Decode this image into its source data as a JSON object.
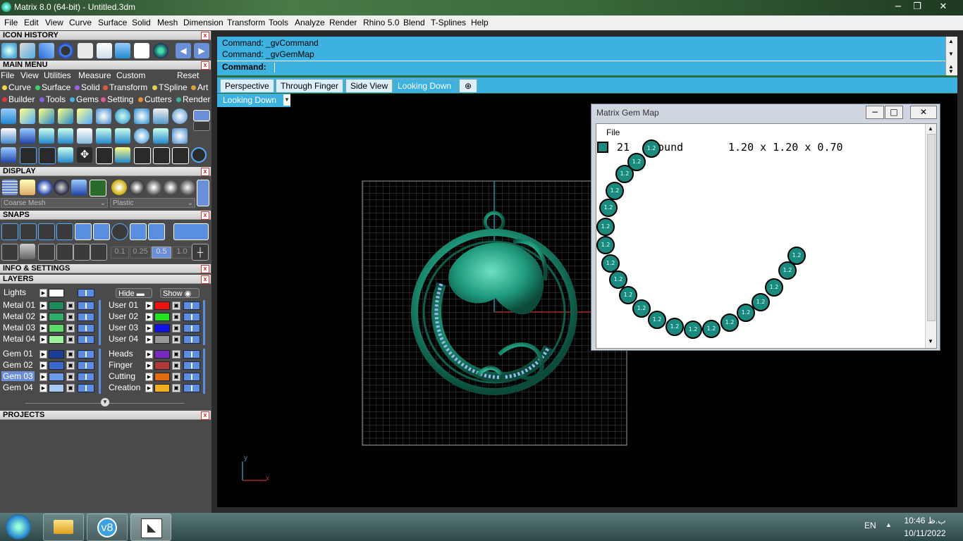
{
  "window": {
    "title": "Matrix 8.0 (64-bit) - Untitled.3dm",
    "min_icon": "minimize-icon",
    "max_icon": "maximize-icon",
    "close_icon": "close-icon"
  },
  "menubar": [
    "File",
    "Edit",
    "View",
    "Curve",
    "Surface",
    "Solid",
    "Mesh",
    "Dimension",
    "Transform",
    "Tools",
    "Analyze",
    "Render",
    "Rhino 5.0",
    "Blend",
    "T-Splines",
    "Help"
  ],
  "panels": {
    "icon_history": "ICON HISTORY",
    "main_menu": "MAIN MENU",
    "display": "DISPLAY",
    "snaps": "SNAPS",
    "info_settings": "INFO & SETTINGS",
    "layers": "LAYERS",
    "projects": "PROJECTS"
  },
  "main_menu": {
    "menus": [
      "File",
      "View",
      "Utilities",
      "Measure",
      "Custom"
    ],
    "reset": "Reset",
    "categories_row1": [
      {
        "label": "Curve",
        "color": "#f5d34a"
      },
      {
        "label": "Surface",
        "color": "#3bd26a"
      },
      {
        "label": "Solid",
        "color": "#a05fe0"
      },
      {
        "label": "Transform",
        "color": "#e05a3a"
      },
      {
        "label": "TSpline",
        "color": "#e0d04a"
      },
      {
        "label": "Art",
        "color": "#e0a03a"
      }
    ],
    "categories_row2": [
      {
        "label": "Builder",
        "color": "#e03a3a"
      },
      {
        "label": "Tools",
        "color": "#8a5fe0"
      },
      {
        "label": "Gems",
        "color": "#4ab0e0"
      },
      {
        "label": "Setting",
        "color": "#e05a9a"
      },
      {
        "label": "Cutters",
        "color": "#e0903a"
      },
      {
        "label": "Render",
        "color": "#3ab0a0"
      }
    ]
  },
  "display": {
    "mesh_select": "Coarse Mesh",
    "material_select": "Plastic"
  },
  "snaps": {
    "values": [
      "0.1",
      "0.25",
      "0.5",
      "1.0"
    ],
    "active_value": "0.5"
  },
  "layers": {
    "lights": "Lights",
    "hide": "Hide",
    "show": "Show",
    "metal": [
      {
        "name": "Metal 01",
        "color": "#1f8a5a"
      },
      {
        "name": "Metal 02",
        "color": "#2fae6a"
      },
      {
        "name": "Metal 03",
        "color": "#5fd86a"
      },
      {
        "name": "Metal 04",
        "color": "#9ef29e"
      }
    ],
    "user": [
      {
        "name": "User 01",
        "color": "#ee1111"
      },
      {
        "name": "User 02",
        "color": "#22e022"
      },
      {
        "name": "User 03",
        "color": "#1111ee"
      },
      {
        "name": "User 04",
        "color": "#9a9a9a"
      }
    ],
    "gem": [
      {
        "name": "Gem 01",
        "color": "#1a3f9a"
      },
      {
        "name": "Gem 02",
        "color": "#3a6ad0"
      },
      {
        "name": "Gem 03",
        "color": "#6a9ae8"
      },
      {
        "name": "Gem 04",
        "color": "#aac8f5"
      }
    ],
    "other": [
      {
        "name": "Heads",
        "color": "#7a2ac0"
      },
      {
        "name": "Finger",
        "color": "#b03a3a"
      },
      {
        "name": "Cutting",
        "color": "#e86a10"
      },
      {
        "name": "Creation",
        "color": "#f0b020"
      }
    ],
    "selected": "Gem 03"
  },
  "command": {
    "history": [
      "Command: _gvCommand",
      "Command: _gvGemMap"
    ],
    "prompt": "Command:",
    "value": ""
  },
  "tabs": [
    "Perspective",
    "Through Finger",
    "Side View",
    "Looking Down"
  ],
  "active_tab": "Looking Down",
  "add_tab_icon": "add-tab-icon",
  "viewport": {
    "name": "Looking Down",
    "axis_x": "x",
    "axis_y": "y"
  },
  "gem_map": {
    "title": "Matrix Gem Map",
    "menu_file": "File",
    "swatch_color": "#1a8a7e",
    "count": "21",
    "shape": "Round",
    "size": "1.20 x 1.20 x 0.70",
    "gem_label": "1.2"
  },
  "taskbar": {
    "lang": "EN",
    "time": "10:46 ب.ظ",
    "date": "10/11/2022"
  }
}
